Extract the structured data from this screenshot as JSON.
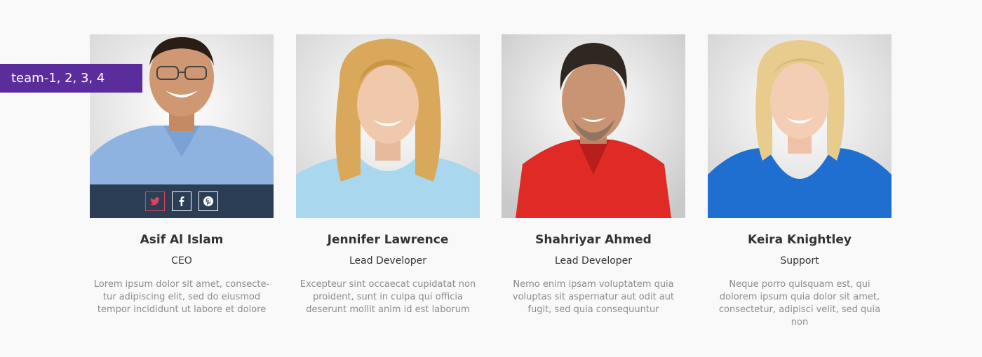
{
  "tag": {
    "label": "team-1, 2, 3, 4"
  },
  "members": [
    {
      "name": "Asif Al Islam",
      "role": "CEO",
      "bio": "Lorem ipsum dolor sit amet, consecte-tur adipiscing elit, sed do eiusmod tempor incididunt ut labore et dolore",
      "social": [
        "twitter-icon",
        "facebook-icon",
        "pinterest-icon"
      ]
    },
    {
      "name": "Jennifer Lawrence",
      "role": "Lead Developer",
      "bio": "Excepteur sint occaecat cupidatat non proident, sunt in culpa qui officia deserunt mollit anim id est laborum"
    },
    {
      "name": "Shahriyar Ahmed",
      "role": "Lead Developer",
      "bio": "Nemo enim ipsam voluptatem quia voluptas sit aspernatur aut odit aut fugit, sed quia consequuntur"
    },
    {
      "name": "Keira Knightley",
      "role": "Support",
      "bio": "Neque porro quisquam est, qui dolorem ipsum quia dolor sit amet, consectetur, adipisci velit, sed quia non"
    }
  ],
  "colors": {
    "tag_bg": "#5b2d9c",
    "social_bar_bg": "#2c3e55",
    "twitter_accent": "#e2425a",
    "name_text": "#333333",
    "bio_text": "#8c8c8c"
  }
}
